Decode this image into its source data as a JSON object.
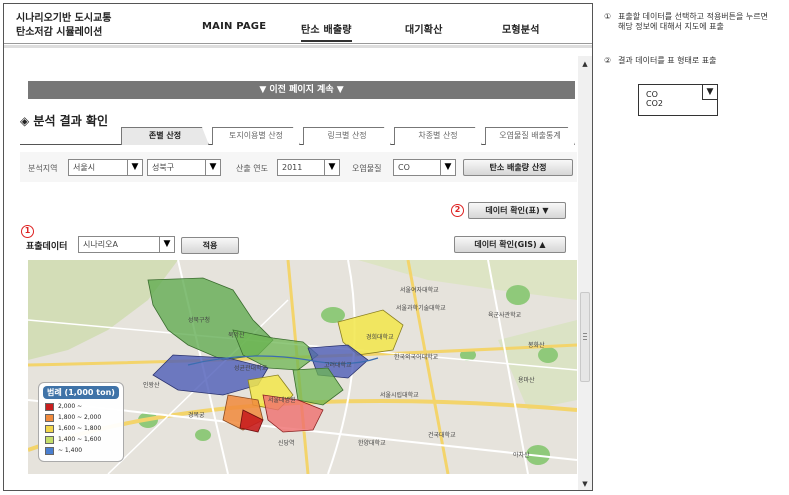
{
  "app": {
    "title_line1": "시나리오기반 도시교통",
    "title_line2": "탄소저감 시뮬레이션"
  },
  "nav": {
    "main": "MAIN PAGE",
    "carbon": "탄소 배출량",
    "air": "대기확산",
    "model": "모형분석"
  },
  "prev_page": "▼ 이전 페이지 계속 ▼",
  "section_title": "◈ 분석 결과 확인",
  "tabs": [
    "존별 산정",
    "토지이용별 산정",
    "링크별 산정",
    "차종별 산정",
    "오염물질 배출통계"
  ],
  "filters": {
    "region_label": "분석지역",
    "city": "서울시",
    "district": "성북구",
    "year_label": "산출 연도",
    "year": "2011",
    "pollutant_label": "오염물질",
    "pollutant": "CO",
    "calc_button": "탄소 배출량 산정"
  },
  "table_toggle": "데이터 확인(표) ▼",
  "gis_toggle": "데이터 확인(GIS) ▲",
  "markers": {
    "one": "1",
    "two": "2"
  },
  "display_data": {
    "label": "표출데이터",
    "scenario": "시나리오A",
    "apply": "적용"
  },
  "legend": {
    "title": "범례 (1,000 ton)",
    "rows": [
      {
        "label": "2,000 ~",
        "color": "#c81e1e"
      },
      {
        "label": "1,800 ~ 2,000",
        "color": "#f08a3c"
      },
      {
        "label": "1,600 ~ 1,800",
        "color": "#f2d64a"
      },
      {
        "label": "1,400 ~ 1,600",
        "color": "#c5de6a"
      },
      {
        "label": "~ 1,400",
        "color": "#4a7fd0"
      }
    ]
  },
  "map_labels": {
    "a": "성북구청",
    "b": "서울여자대학교",
    "c": "서울과학기술대학교",
    "d": "육군사관학교",
    "e": "고려대학교",
    "f": "경희대학교",
    "g": "성균관대학교",
    "h": "한국외국어대학교",
    "i": "건국대학교",
    "j": "서울시립대학교",
    "k": "한양대학교",
    "l": "신당역",
    "m": "봉화산",
    "n": "용마산",
    "o": "아차산",
    "p": "인왕산",
    "q": "북악산",
    "r": "경복궁",
    "s": "서울대병원"
  },
  "notes": {
    "n1_num": "①",
    "n1_text": "표출할 데이터를 선택하고 적용버튼을 누르면 해당 정보에 대해서 지도에 표출",
    "n2_num": "②",
    "n2_text": "결과 데이터를 표 형태로 표출",
    "preview_options": [
      "CO",
      "CO2"
    ]
  },
  "icons": {
    "dropdown": "▼",
    "scroll_up": "▲",
    "scroll_down": "▼"
  }
}
